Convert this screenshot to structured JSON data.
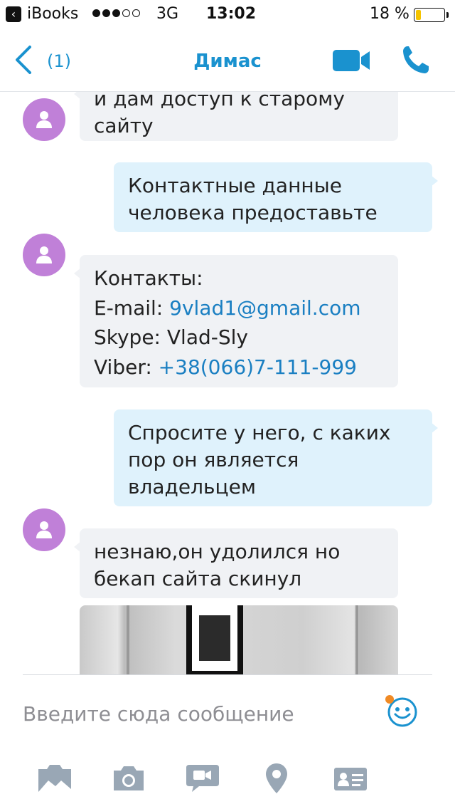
{
  "status_bar": {
    "app": "iBooks",
    "network": "3G",
    "time": "13:02",
    "battery_pct": "18 %",
    "battery_level": 0.18,
    "signal_bars_on": 3,
    "signal_bars_total": 5
  },
  "nav": {
    "back_count": "(1)",
    "title": "Димас",
    "accent_color": "#1a92cf"
  },
  "messages": [
    {
      "dir": "in",
      "lines": [
        "и дам доступ к старому",
        "сайту"
      ]
    },
    {
      "dir": "out",
      "lines": [
        "Контактные данные",
        "человека предоставьте"
      ]
    },
    {
      "dir": "in",
      "contacts": {
        "heading": "Контакты:",
        "email_label": "E-mail: ",
        "email": "9vlad1@gmail.com",
        "skype": "Skype: Vlad-Sly",
        "viber_label": "Viber: ",
        "viber": "+38(066)7-111-999"
      }
    },
    {
      "dir": "out",
      "lines": [
        "Спросите у него, с каких",
        "пор он является",
        "владельцем"
      ]
    },
    {
      "dir": "in",
      "lines": [
        "незнаю,он удолился но",
        "бекап сайта скинул"
      ]
    }
  ],
  "compose": {
    "placeholder": "Введите сюда сообщение"
  },
  "toolbar_icons": [
    "photo-gallery-icon",
    "camera-icon",
    "video-message-icon",
    "location-pin-icon",
    "contact-card-icon"
  ]
}
